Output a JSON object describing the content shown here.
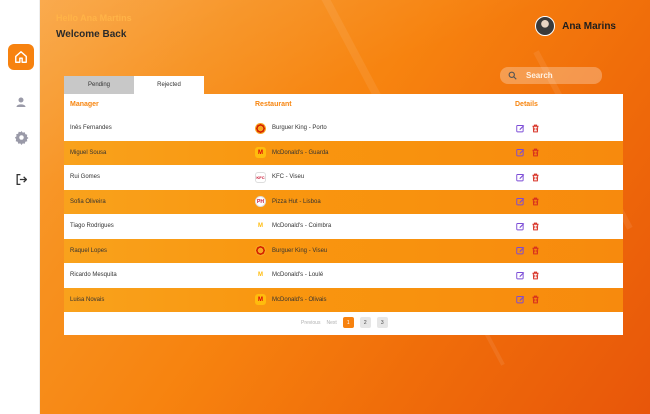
{
  "sidebar": {
    "items": [
      {
        "name": "home",
        "icon": "home-icon",
        "active": true
      },
      {
        "name": "profile",
        "icon": "user-icon",
        "active": false
      },
      {
        "name": "settings",
        "icon": "gear-icon",
        "active": false
      },
      {
        "name": "logout",
        "icon": "logout-icon",
        "active": false
      }
    ]
  },
  "header": {
    "greeting": "Hello Ana Martins",
    "subtitle": "Welcome Back",
    "user_name": "Ana Marins"
  },
  "search": {
    "placeholder": "Search"
  },
  "tabs": [
    {
      "label": "Pending",
      "active": false
    },
    {
      "label": "Rejected",
      "active": true
    }
  ],
  "table": {
    "headers": {
      "manager": "Manager",
      "restaurant": "Restaurant",
      "details": "Details"
    },
    "rows": [
      {
        "manager": "Inês Fernandes",
        "restaurant": "Burguer King - Porto",
        "logo": "bk"
      },
      {
        "manager": "Miguel Sousa",
        "restaurant": "McDonald's - Guarda",
        "logo": "mc"
      },
      {
        "manager": "Rui Gomes",
        "restaurant": "KFC - Viseu",
        "logo": "kfc"
      },
      {
        "manager": "Sofia Oliveira",
        "restaurant": "Pizza Hut - Lisboa",
        "logo": "ph"
      },
      {
        "manager": "Tiago Rodrigues",
        "restaurant": "McDonald's - Coimbra",
        "logo": "mc-plain"
      },
      {
        "manager": "Raquel Lopes",
        "restaurant": "Burguer King - Viseu",
        "logo": "bk"
      },
      {
        "manager": "Ricardo Mesquita",
        "restaurant": "McDonald's - Loulé",
        "logo": "mc-plain"
      },
      {
        "manager": "Luisa Novais",
        "restaurant": "McDonald's - Olivais",
        "logo": "mc"
      }
    ]
  },
  "pagination": {
    "previous_label": "Previous",
    "next_label": "Next",
    "pages": [
      "1",
      "2",
      "3"
    ],
    "current": "1"
  },
  "colors": {
    "accent": "#f7820f",
    "edit": "#7b4bd6",
    "delete": "#d62b1f"
  }
}
